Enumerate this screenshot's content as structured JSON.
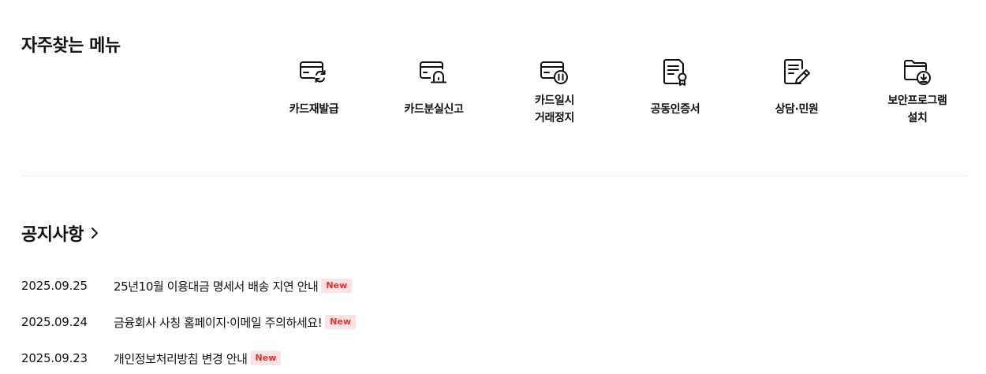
{
  "frequent_menu": {
    "title": "자주찾는 메뉴",
    "items": [
      {
        "label": "카드재발급",
        "icon": "card-reissue-icon"
      },
      {
        "label": "카드분실신고",
        "icon": "card-lost-report-icon"
      },
      {
        "label": "카드일시\n거래정지",
        "icon": "card-pause-icon"
      },
      {
        "label": "공동인증서",
        "icon": "certificate-icon"
      },
      {
        "label": "상담·민원",
        "icon": "counsel-document-icon"
      },
      {
        "label": "보안프로그램\n설치",
        "icon": "security-program-download-icon"
      }
    ]
  },
  "notices": {
    "title": "공지사항",
    "badge_label": "New",
    "items": [
      {
        "date": "2025.09.25",
        "text": "25년10월 이용대금 명세서 배송 지연 안내",
        "badge": "New"
      },
      {
        "date": "2025.09.24",
        "text": "금융회사 사칭 홈페이지·이메일 주의하세요!",
        "badge": "New"
      },
      {
        "date": "2025.09.23",
        "text": "개인정보처리방침 변경 안내",
        "badge": "New"
      }
    ]
  },
  "colors": {
    "text": "#111111",
    "badge_bg": "#fbe3e3",
    "badge_text": "#e0312f",
    "divider": "#ececec"
  }
}
